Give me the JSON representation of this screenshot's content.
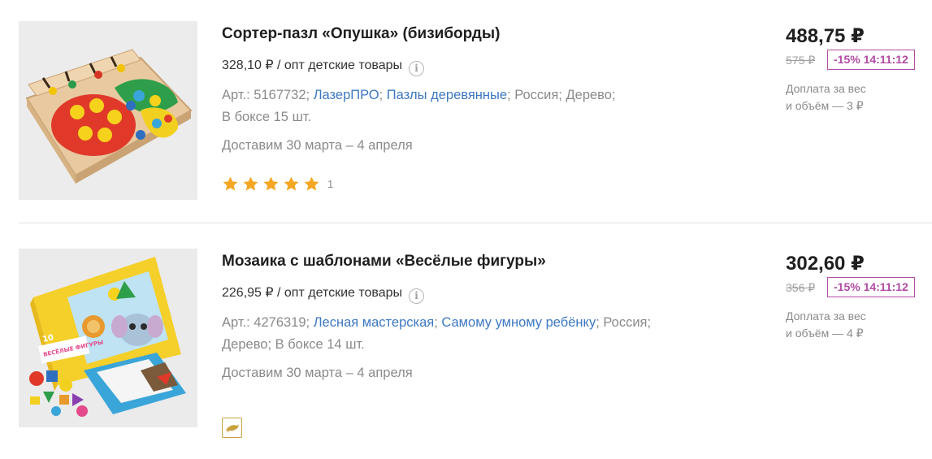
{
  "products": [
    {
      "title": "Сортер-пазл «Опушка» (бизиборды)",
      "wholesale_price": "328,10 ₽ / опт детские товары",
      "attrs": {
        "art": "Арт.: 5167732;",
        "brand": "ЛазерПРО",
        "sep1": ";",
        "category": "Пазлы деревянные",
        "rest1": "; Россия; Дерево;",
        "rest2": "В боксе 15 шт."
      },
      "delivery": "Доставим 30 марта – 4 апреля",
      "rating": 5,
      "review_count": "1",
      "price": "488,75 ₽",
      "old_price": "575 ₽",
      "discount": "-15% 14:11:12",
      "surcharge_line1": "Доплата за вес",
      "surcharge_line2": "и объём — 3 ₽"
    },
    {
      "title": "Мозаика с шаблонами «Весёлые фигуры»",
      "wholesale_price": "226,95 ₽ / опт детские товары",
      "attrs": {
        "art": "Арт.: 4276319;",
        "brand": "Лесная мастерская",
        "sep1": ";",
        "category": "Самому умному ребёнку",
        "rest1": "; Россия;",
        "rest2": "Дерево; В боксе 14 шт."
      },
      "delivery": "Доставим 30 марта – 4 апреля",
      "price": "302,60 ₽",
      "old_price": "356 ₽",
      "discount": "-15% 14:11:12",
      "surcharge_line1": "Доплата за вес",
      "surcharge_line2": "и объём — 4 ₽",
      "promo_icon": "dolphin-icon"
    }
  ],
  "colors": {
    "link": "#3d78c2",
    "discount": "#b24ba3",
    "star": "#f5a623",
    "promo_border": "#c8a23c"
  },
  "box_print": {
    "line1": "ВЕСЁЛЫЕ ФИГУРЫ",
    "number": "10"
  }
}
